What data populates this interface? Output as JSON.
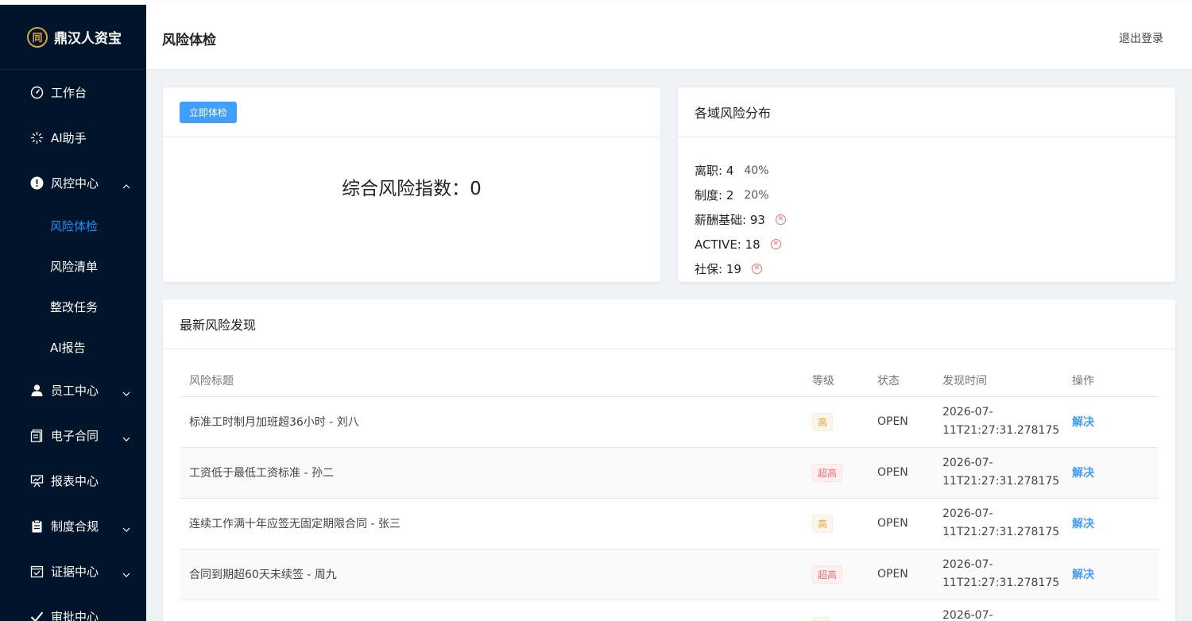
{
  "brand": {
    "logo_glyph": "同",
    "name": "鼎汉人资宝"
  },
  "sidebar": {
    "items": [
      {
        "label": "工作台",
        "icon": "dashboard-icon"
      },
      {
        "label": "AI助手",
        "icon": "sparkle-icon"
      },
      {
        "label": "风控中心",
        "icon": "alert-circle-icon",
        "expanded": true,
        "children": [
          {
            "label": "风险体检",
            "active": true
          },
          {
            "label": "风险清单"
          },
          {
            "label": "整改任务"
          },
          {
            "label": "AI报告"
          }
        ]
      },
      {
        "label": "员工中心",
        "icon": "user-icon"
      },
      {
        "label": "电子合同",
        "icon": "contract-icon"
      },
      {
        "label": "报表中心",
        "icon": "presentation-icon"
      },
      {
        "label": "制度合规",
        "icon": "clipboard-icon"
      },
      {
        "label": "证据中心",
        "icon": "evidence-icon"
      },
      {
        "label": "审批中心",
        "icon": "check-icon"
      }
    ]
  },
  "header": {
    "title": "风险体检",
    "logout_label": "退出登录"
  },
  "check_card": {
    "button_label": "立即体检",
    "score_text": "综合风险指数：0"
  },
  "dist_card": {
    "title": "各域风险分布",
    "rows": [
      {
        "label": "离职: 4",
        "percent": "40%"
      },
      {
        "label": "制度: 2",
        "percent": "20%"
      },
      {
        "label": "薪酬基础: 93",
        "percent": null,
        "error": true
      },
      {
        "label": "ACTIVE: 18",
        "percent": null,
        "error": true
      },
      {
        "label": "社保: 19",
        "percent": null,
        "error": true
      }
    ]
  },
  "latest_card": {
    "title": "最新风险发现",
    "columns": [
      "风险标题",
      "等级",
      "状态",
      "发现时间",
      "操作"
    ],
    "rows": [
      {
        "title": "标准工时制月加班超36小时 - 刘八",
        "level": "高",
        "status": "OPEN",
        "time_line1": "2026-07-",
        "time_line2": "11T21:27:31.278175",
        "action": "解决"
      },
      {
        "title": "工资低于最低工资标准 - 孙二",
        "level": "超高",
        "status": "OPEN",
        "time_line1": "2026-07-",
        "time_line2": "11T21:27:31.278175",
        "action": "解决"
      },
      {
        "title": "连续工作满十年应签无固定期限合同 - 张三",
        "level": "高",
        "status": "OPEN",
        "time_line1": "2026-07-",
        "time_line2": "11T21:27:31.278175",
        "action": "解决"
      },
      {
        "title": "合同到期超60天未续签 - 周九",
        "level": "超高",
        "status": "OPEN",
        "time_line1": "2026-07-",
        "time_line2": "11T21:27:31.278175",
        "action": "解决"
      },
      {
        "title": "",
        "level": "",
        "status": "",
        "time_line1": "2026-07-",
        "time_line2": "",
        "action": ""
      }
    ]
  },
  "colors": {
    "sidebar_bg": "#001529",
    "accent": "#409eff",
    "brand_gold": "#d9a441",
    "tag_high": "#e6a23c",
    "tag_super": "#f56c6c"
  }
}
